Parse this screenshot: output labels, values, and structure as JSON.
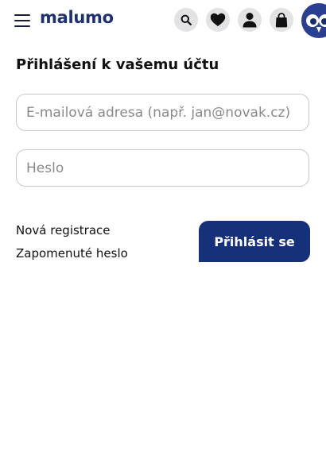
{
  "header": {
    "logo_text": "malumo",
    "icons": {
      "menu": "hamburger-icon",
      "search": "search-icon",
      "favorites": "heart-icon",
      "account": "user-icon",
      "cart": "shopping-bag-icon",
      "mascot": "owl-logo-icon"
    }
  },
  "login": {
    "title": "Přihlášení k vašemu účtu",
    "email_placeholder": "E-mailová adresa (např. jan@novak.cz)",
    "email_value": "",
    "password_placeholder": "Heslo",
    "password_value": "",
    "register_link": "Nová registrace",
    "forgot_link": "Zapomenuté heslo",
    "submit_label": "Přihlásit se"
  },
  "colors": {
    "brand": "#1e3272",
    "button": "#16307a",
    "icon_bg": "#e3e3e5",
    "border": "#c9c9c9"
  }
}
